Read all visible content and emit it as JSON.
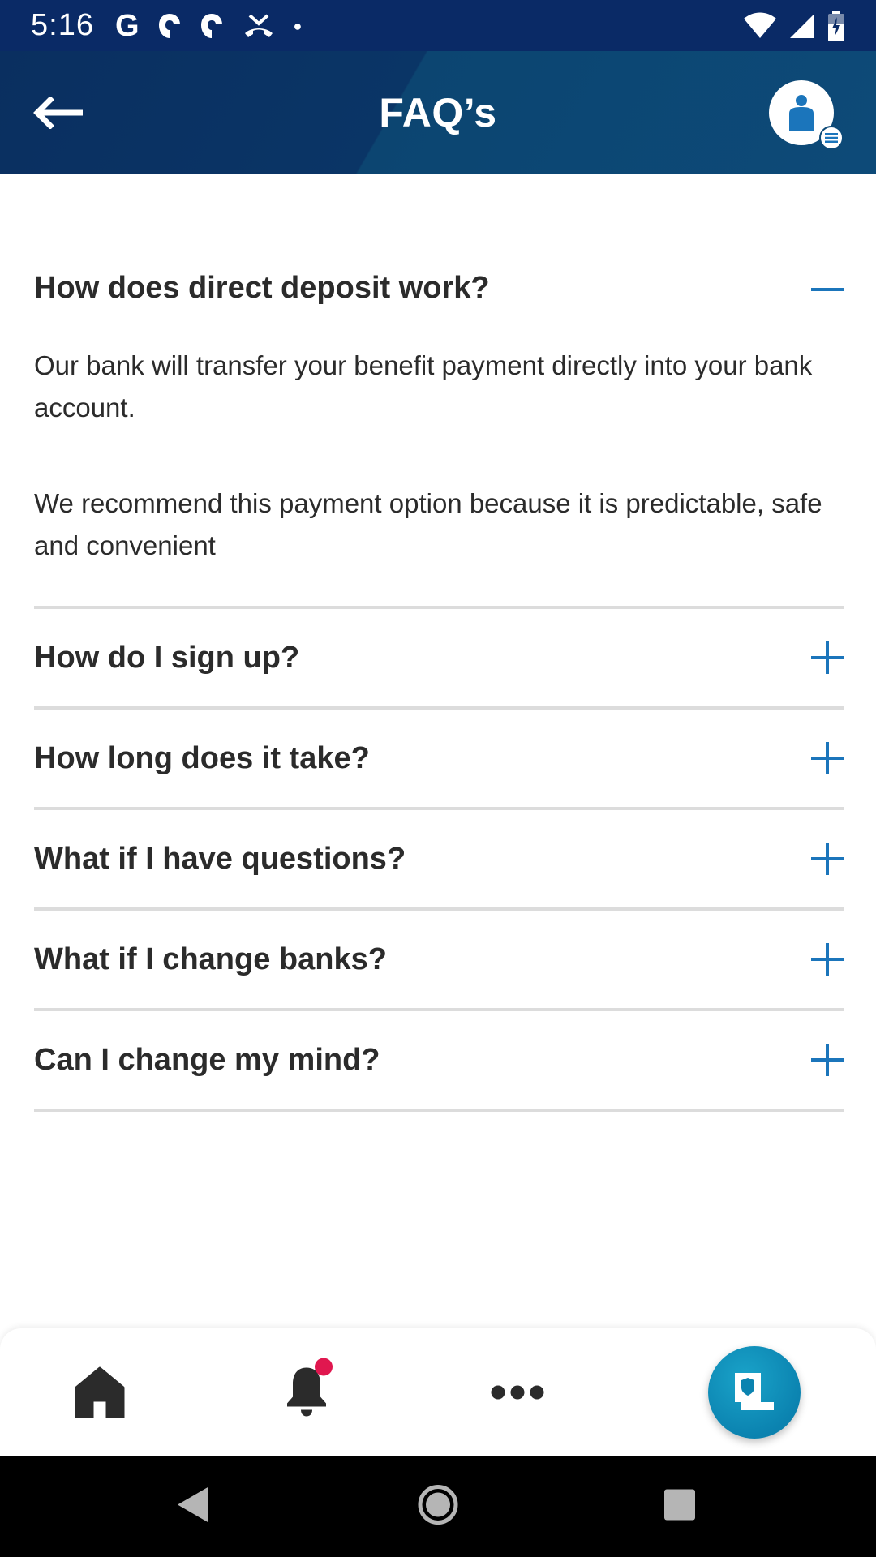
{
  "status_bar": {
    "time": "5:16"
  },
  "header": {
    "title": "FAQ’s"
  },
  "faq": [
    {
      "question": "How does direct deposit work?",
      "expanded": true,
      "answer": [
        "Our bank will transfer your benefit payment directly into your bank account.",
        "We recommend this payment option because it is predictable, safe and convenient"
      ]
    },
    {
      "question": "How do I sign up?",
      "expanded": false
    },
    {
      "question": "How long does it take?",
      "expanded": false
    },
    {
      "question": "What if I have questions?",
      "expanded": false
    },
    {
      "question": "What if I change banks?",
      "expanded": false
    },
    {
      "question": "Can I change my mind?",
      "expanded": false
    }
  ],
  "bottom_nav": {
    "items": [
      {
        "icon": "home-icon"
      },
      {
        "icon": "bell-icon",
        "has_notification": true
      },
      {
        "icon": "more-icon"
      },
      {
        "icon": "document-shield-icon"
      }
    ]
  },
  "colors": {
    "status_bar": "#0a2a66",
    "header": "#0d4a78",
    "accent": "#1b75bb",
    "fab": "#0b83b0",
    "notification": "#e0174f"
  }
}
